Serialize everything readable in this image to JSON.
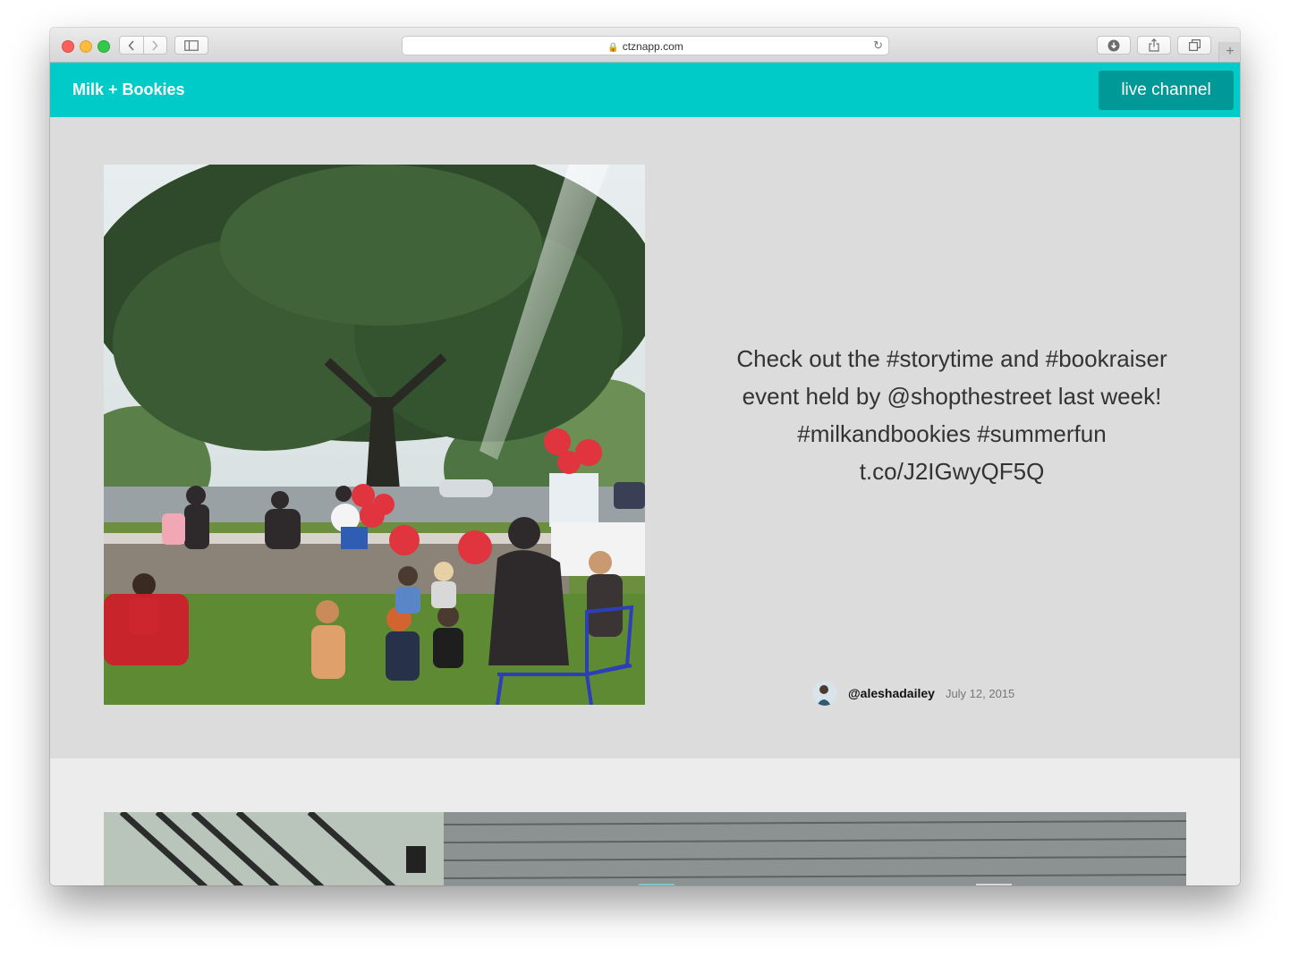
{
  "browser": {
    "url": "ctznapp.com",
    "icons": {
      "back": "chevron-left-icon",
      "forward": "chevron-right-icon",
      "sidebar": "sidebar-icon",
      "lock": "lock-icon",
      "reload": "reload-icon",
      "download": "download-icon",
      "share": "share-icon",
      "tabs": "tabs-icon",
      "new_tab": "plus-icon"
    }
  },
  "site": {
    "brand": "Milk + Bookies",
    "live_button": "live channel",
    "colors": {
      "header": "#00cbc9",
      "button": "#009997"
    }
  },
  "post": {
    "text_lines": [
      "Check out the #storytime and #bookraiser",
      "event held by @shopthestreet last week!",
      "#milkandbookies #summerfun",
      "t.co/J2IGwyQF5Q"
    ],
    "author": "@aleshadailey",
    "date": "July 12, 2015"
  }
}
